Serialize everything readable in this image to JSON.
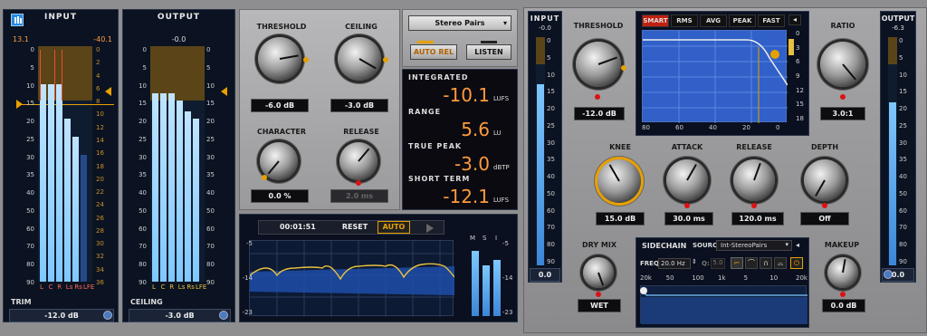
{
  "input_panel": {
    "title": "INPUT",
    "peak_left": "13.1",
    "peak_right": "-40.1",
    "scale": [
      "0",
      "5",
      "10",
      "15",
      "20",
      "25",
      "30",
      "35",
      "40",
      "50",
      "60",
      "70",
      "80",
      "90"
    ],
    "right_scale": [
      "0",
      "2",
      "4",
      "6",
      "8",
      "10",
      "12",
      "14",
      "16",
      "18",
      "20",
      "22",
      "24",
      "26",
      "28",
      "30",
      "32",
      "34",
      "36"
    ],
    "channels": [
      "L",
      "C",
      "R",
      "Ls",
      "Rs",
      "LFE"
    ],
    "trim_label": "TRIM",
    "trim_value": "-12.0 dB"
  },
  "output_panel": {
    "title": "OUTPUT",
    "peak": "-0.0",
    "scale": [
      "0",
      "5",
      "10",
      "15",
      "20",
      "25",
      "30",
      "35",
      "40",
      "50",
      "60",
      "70",
      "80",
      "90"
    ],
    "channels": [
      "L",
      "C",
      "R",
      "Ls",
      "Rs",
      "LFE"
    ],
    "ceiling_label": "CEILING",
    "ceiling_value": "-3.0 dB"
  },
  "limiter": {
    "threshold_label": "THRESHOLD",
    "threshold_value": "-6.0 dB",
    "ceiling_label": "CEILING",
    "ceiling_value": "-3.0 dB",
    "character_label": "CHARACTER",
    "character_value": "0.0 %",
    "release_label": "RELEASE",
    "release_value": "2.0 ms"
  },
  "loudness": {
    "mode": "Stereo Pairs",
    "auto_rel": "AUTO REL",
    "listen": "LISTEN",
    "integrated_label": "INTEGRATED",
    "integrated_value": "-10.1",
    "integrated_unit": "LUFS",
    "range_label": "RANGE",
    "range_value": "5.6",
    "range_unit": "LU",
    "truepeak_label": "TRUE PEAK",
    "truepeak_value": "-3.0",
    "truepeak_unit": "dBTP",
    "shortterm_label": "SHORT TERM",
    "shortterm_value": "-12.1",
    "shortterm_unit": "LUFS"
  },
  "history": {
    "time": "00:01:51",
    "reset": "RESET",
    "auto": "AUTO",
    "scale": [
      "-5",
      "-14",
      "-23"
    ],
    "msi": [
      "M",
      "S",
      "I"
    ]
  },
  "comp": {
    "input_title": "INPUT",
    "input_peak": "-0.0",
    "input_value": "0.0",
    "threshold_label": "THRESHOLD",
    "threshold_value": "-12.0 dB",
    "tabs": [
      "SMART",
      "RMS",
      "AVG",
      "PEAK",
      "FAST"
    ],
    "graph_x": [
      "80",
      "60",
      "40",
      "20",
      "0"
    ],
    "graph_y": [
      "0",
      "3",
      "6",
      "9",
      "12",
      "15",
      "18"
    ],
    "ratio_label": "RATIO",
    "ratio_value": "3.0:1",
    "output_title": "OUTPUT",
    "output_peak": "-6.3",
    "output_value": "0.0",
    "knee_label": "KNEE",
    "knee_value": "15.0 dB",
    "attack_label": "ATTACK",
    "attack_value": "30.0 ms",
    "release_label": "RELEASE",
    "release_value": "120.0 ms",
    "depth_label": "DEPTH",
    "depth_value": "Off",
    "drymix_label": "DRY MIX",
    "drymix_value": "WET",
    "sidechain_label": "SIDECHAIN",
    "source_label": "SOURCE:",
    "source_value": "Int-StereoPairs",
    "freq_label": "FREQ:",
    "freq_value": "20.0 Hz",
    "q_label": "Q:",
    "q_value": "5.0",
    "sc_ticks": [
      "20k",
      "50",
      "100",
      "1k",
      "5",
      "10",
      "20k"
    ],
    "makeup_label": "MAKEUP",
    "makeup_value": "0.0 dB"
  }
}
